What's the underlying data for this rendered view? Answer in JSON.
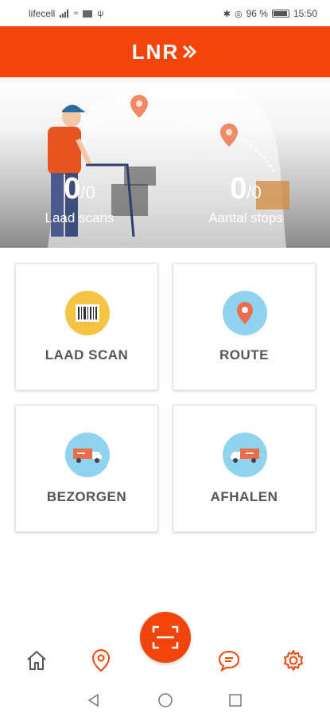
{
  "status_bar": {
    "carrier": "lifecell",
    "battery_percent": "96 %",
    "time": "15:50"
  },
  "header": {
    "logo_text": "LNR",
    "brand_color": "#f2450c"
  },
  "hero": {
    "load_scans": {
      "count": "0",
      "total": "/0",
      "label": "Laad scans"
    },
    "stops": {
      "count": "0",
      "total": "/0",
      "label": "Aantal stops"
    }
  },
  "tiles": [
    {
      "label": "LAAD SCAN",
      "icon": "barcode-icon",
      "circle_color": "#f6c343"
    },
    {
      "label": "ROUTE",
      "icon": "map-pin-icon",
      "circle_color": "#8fd3ef"
    },
    {
      "label": "BEZORGEN",
      "icon": "delivery-truck-icon",
      "circle_color": "#8fd3ef"
    },
    {
      "label": "AFHALEN",
      "icon": "pickup-truck-icon",
      "circle_color": "#8fd3ef"
    }
  ],
  "bottom_nav": {
    "items": [
      "home-icon",
      "location-icon",
      "scan-icon",
      "chat-icon",
      "settings-icon"
    ],
    "icon_color": "#f2450c"
  },
  "system_nav": [
    "back-icon",
    "home-circle-icon",
    "recents-icon"
  ]
}
